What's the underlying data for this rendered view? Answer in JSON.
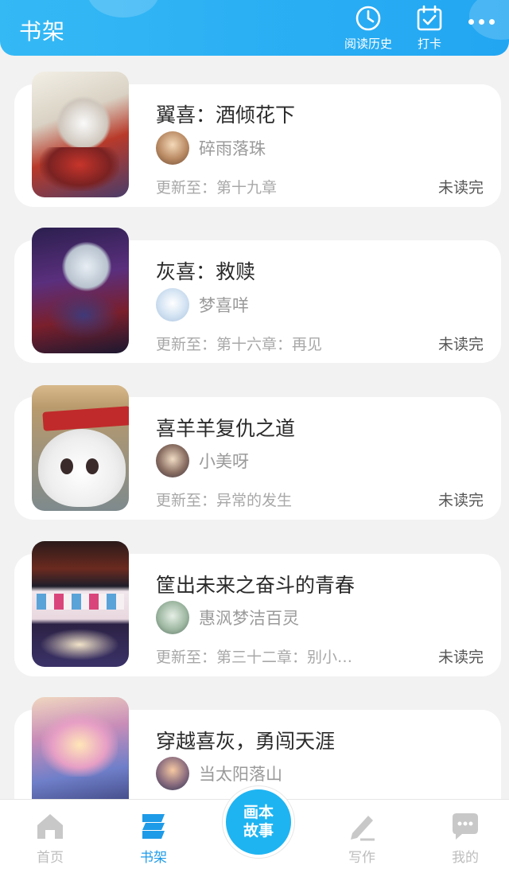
{
  "header": {
    "title": "书架",
    "history_label": "阅读历史",
    "checkin_label": "打卡"
  },
  "books": [
    {
      "title": "翼喜：酒倾花下",
      "author": "碎雨落珠",
      "update": "更新至：第十九章",
      "status": "未读完"
    },
    {
      "title": "灰喜：救赎",
      "author": "梦喜咩",
      "update": "更新至：第十六章：再见",
      "status": "未读完"
    },
    {
      "title": "喜羊羊复仇之道",
      "author": "小美呀",
      "update": "更新至：异常的发生",
      "status": "未读完"
    },
    {
      "title": "筐出未来之奋斗的青春",
      "author": "惠沨梦洁百灵",
      "update": "更新至：第三十二章：别小…",
      "status": "未读完"
    },
    {
      "title": "穿越喜灰，勇闯天涯",
      "author": "当太阳落山",
      "update": "",
      "status": ""
    }
  ],
  "tabbar": {
    "home": "首页",
    "shelf": "书架",
    "center_line1": "画本",
    "center_line2": "故事",
    "write": "写作",
    "mine": "我的"
  },
  "colors": {
    "header": "#22a6f2",
    "active_tab": "#1e9be8",
    "center_button": "#1eb4f2"
  }
}
